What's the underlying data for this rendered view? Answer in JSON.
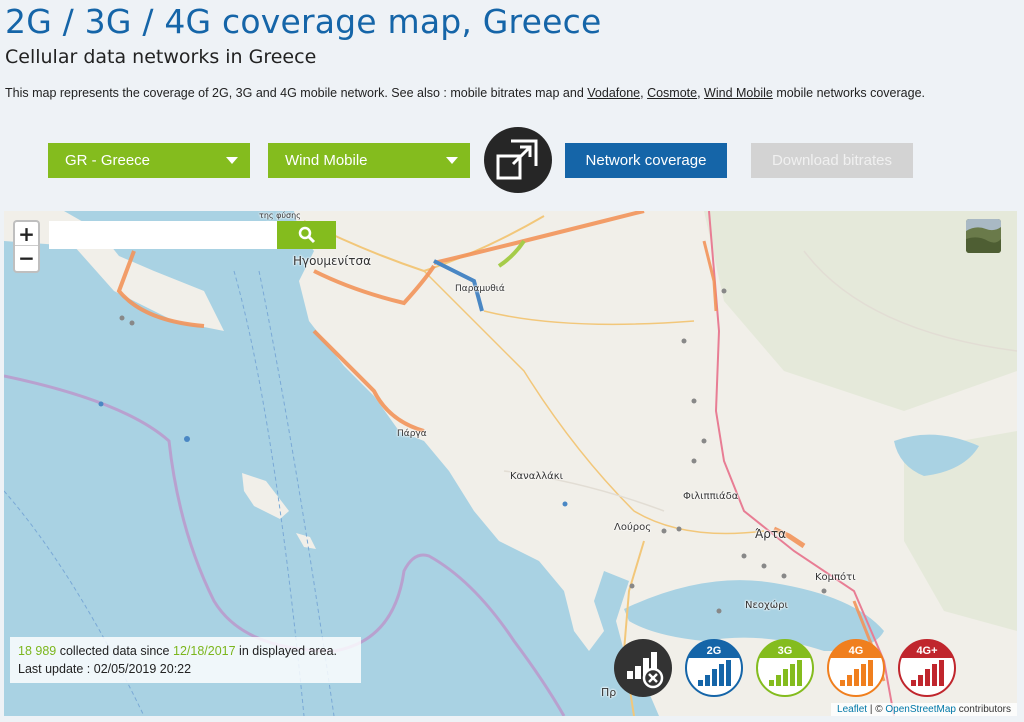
{
  "header": {
    "title": "2G / 3G / 4G coverage map, Greece",
    "subtitle": "Cellular data networks in Greece",
    "description_prefix": "This map represents the coverage of 2G, 3G and 4G mobile network. See also : mobile bitrates map and",
    "links": [
      "Vodafone",
      "Cosmote",
      "Wind Mobile"
    ],
    "description_suffix": "mobile networks coverage."
  },
  "controls": {
    "country_select": "GR - Greece",
    "operator_select": "Wind Mobile",
    "fullscreen_icon": "expand-icon",
    "network_coverage": "Network coverage",
    "download_bitrates": "Download bitrates"
  },
  "map": {
    "search_placeholder": "",
    "zoom_in": "+",
    "zoom_out": "−",
    "place_labels": {
      "igoumenitsa": "Ηγουμενίτσα",
      "paramythia": "Παραμυθιά",
      "parga": "Πάργα",
      "kanallaki": "Καναλλάκι",
      "filippiada": "Φιλιππιάδα",
      "louros": "Λούρος",
      "arta": "Άρτα",
      "kompoti": "Κομπότι",
      "neochori": "Νεοχώρι",
      "fysis": "της φύσης",
      "preveza": "Πρ"
    },
    "info": {
      "count": "18 989",
      "text1": "collected data since",
      "since": "12/18/2017",
      "text2": "in displayed area.",
      "last_update": "Last update : 02/05/2019 20:22"
    },
    "legend": [
      {
        "label": "",
        "icon": "no-data-icon",
        "color": "#333333"
      },
      {
        "label": "2G",
        "icon": "signal-2g-icon",
        "color": "#1565a8"
      },
      {
        "label": "3G",
        "icon": "signal-3g-icon",
        "color": "#84bc1e"
      },
      {
        "label": "4G",
        "icon": "signal-4g-icon",
        "color": "#f07f1e"
      },
      {
        "label": "4G+",
        "icon": "signal-4gplus-icon",
        "color": "#c0262d"
      }
    ],
    "attribution": {
      "leaflet": "Leaflet",
      "sep": "| ©",
      "osm": "OpenStreetMap",
      "contributors": "contributors"
    }
  }
}
